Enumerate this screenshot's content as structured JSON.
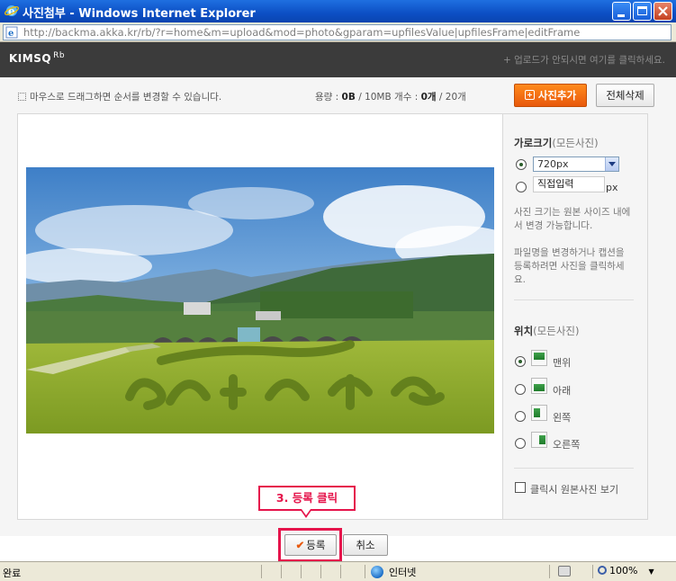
{
  "window": {
    "title": "사진첨부 - Windows Internet Explorer",
    "url": "http://backma.akka.kr/rb/?r=home&m=upload&mod=photo&gparam=upfilesValue|upfilesFrame|editFrame"
  },
  "header": {
    "logo": "KIMSQ",
    "logo_sup": "Rb",
    "hint": "+ 업로드가 안되시면 여기를 클릭하세요."
  },
  "toolbar": {
    "drag_hint": "마우스로 드래그하면 순서를 변경할 수 있습니다.",
    "capacity_label": "용량 : ",
    "capacity_used": "0B",
    "capacity_max": " / 10MB",
    "count_label": "  개수 : ",
    "count_used": "0개",
    "count_max": " / 20개",
    "add_photo": "사진추가",
    "delete_all": "전체삭제"
  },
  "side": {
    "width_title": "가로크기",
    "width_sub": "(모든사진)",
    "width_option": "720px",
    "custom_value": "직접입력",
    "px_unit": "px",
    "note1": "사진 크기는 원본 사이즈 내에서 변경 가능합니다.",
    "note2": "파일명을 변경하거나 캡션을 등록하려면 사진을 클릭하세요.",
    "position_title": "위치",
    "position_sub": "(모든사진)",
    "positions": [
      "맨위",
      "아래",
      "왼쪽",
      "오른쪽"
    ],
    "view_original": "클릭시 원본사진 보기"
  },
  "callout": {
    "text": "3. 등록 클릭"
  },
  "actions": {
    "register": "등록",
    "cancel": "취소"
  },
  "statusbar": {
    "status": "완료",
    "zone": "인터넷",
    "zoom": "100%"
  },
  "colors": {
    "accent": "#e8590c",
    "callout": "#e5144b",
    "titlebar": "#0c4fc4",
    "header": "#3b3b3b"
  }
}
